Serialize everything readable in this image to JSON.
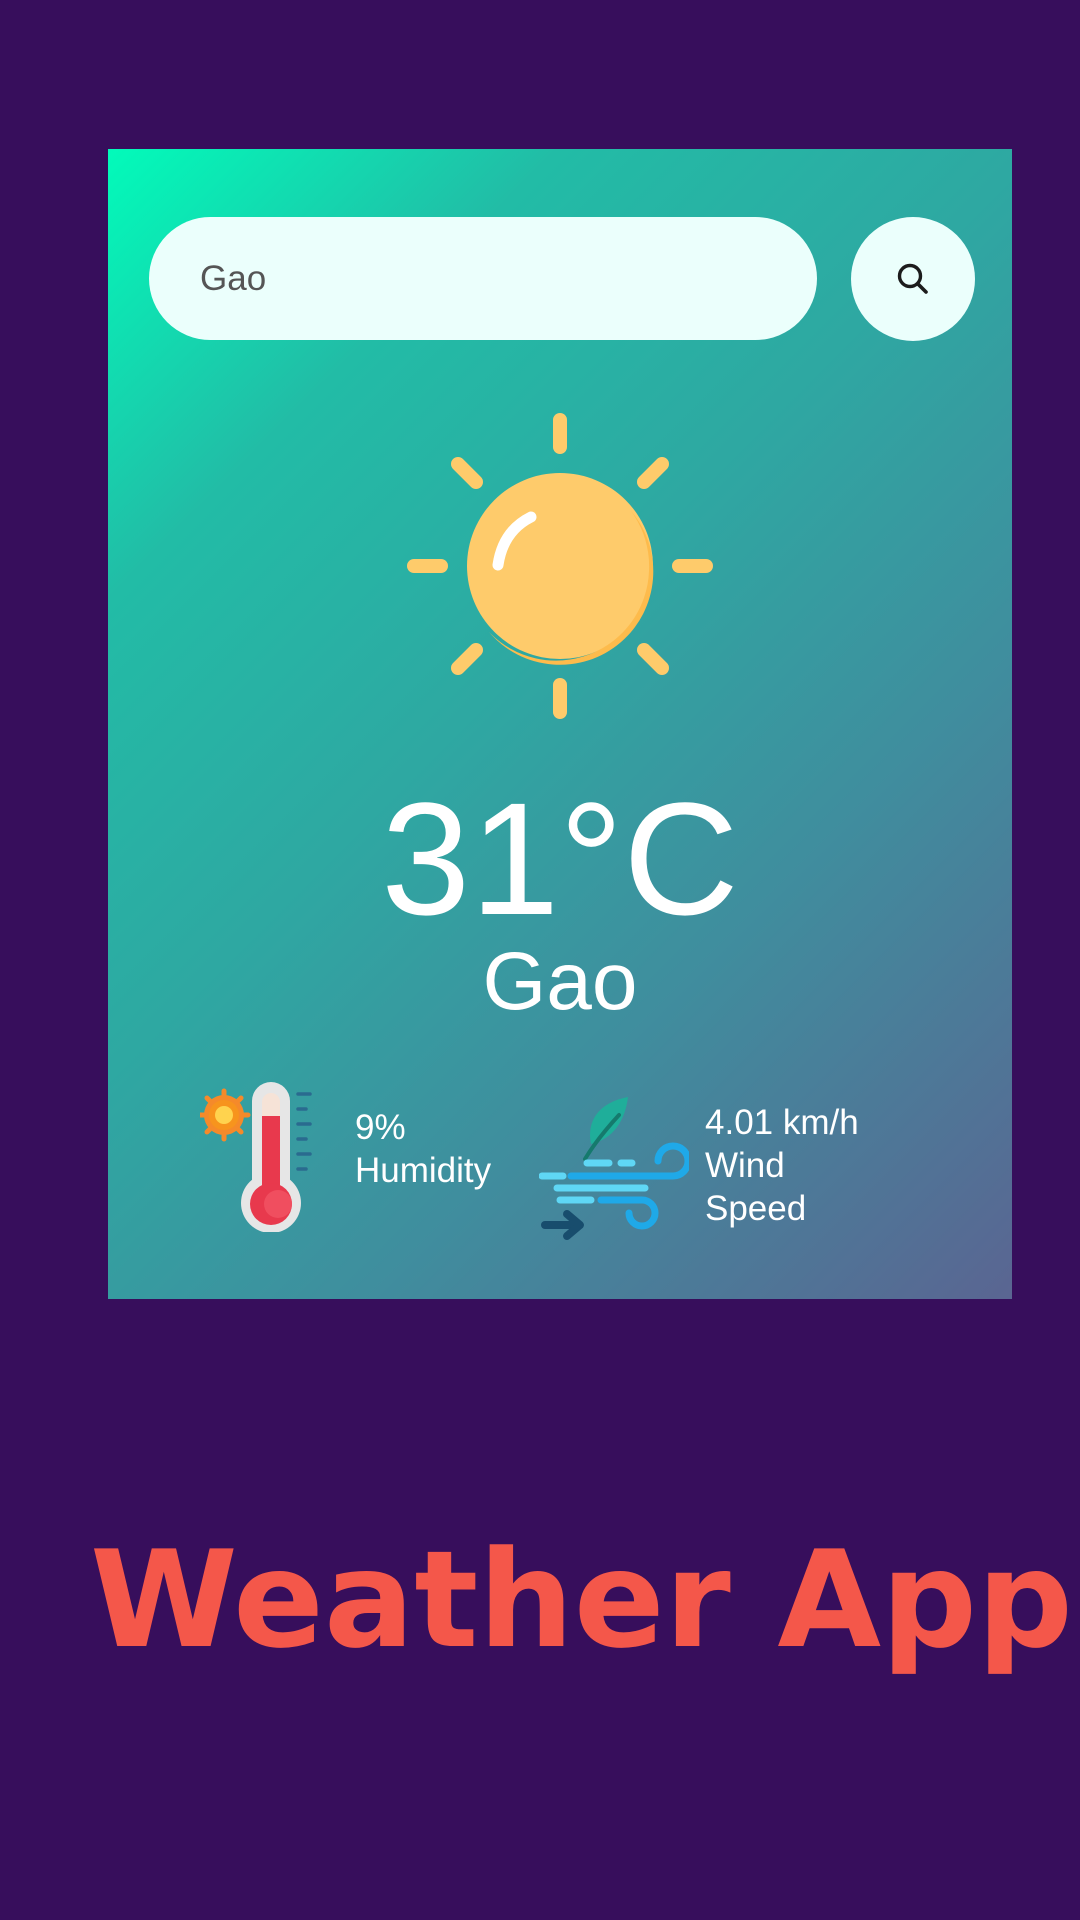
{
  "search": {
    "value": "Gao",
    "icon": "search-icon"
  },
  "weather": {
    "icon": "sun-icon",
    "temperature": "31°C",
    "city": "Gao"
  },
  "details": {
    "humidity": {
      "icon": "thermometer-icon",
      "value": "9%",
      "label": "Humidity"
    },
    "wind": {
      "icon": "wind-icon",
      "value": "4.01 km/h",
      "label_line1": "Wind",
      "label_line2": "Speed"
    }
  },
  "app_title": "Weather App",
  "colors": {
    "page_background": "#370e5c",
    "card_gradient_start": "#02fbba",
    "card_gradient_end": "#5a6592",
    "search_background": "#ebfffc",
    "sun": "#fecb6b",
    "title": "#f4574a"
  }
}
